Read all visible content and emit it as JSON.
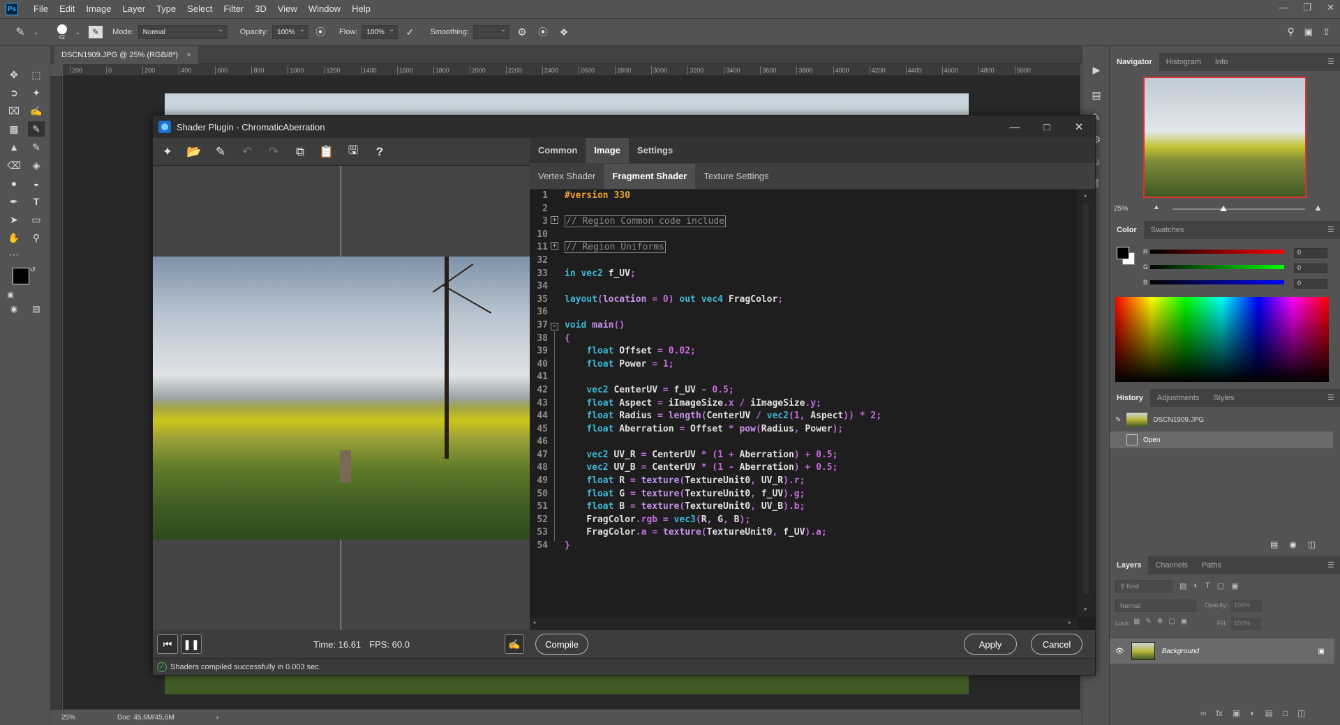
{
  "app": {
    "logo": "Ps",
    "menu": [
      "File",
      "Edit",
      "Image",
      "Layer",
      "Type",
      "Select",
      "Filter",
      "3D",
      "View",
      "Window",
      "Help"
    ]
  },
  "options_bar": {
    "brush_size": "42",
    "mode_label": "Mode:",
    "mode_value": "Normal",
    "opacity_label": "Opacity:",
    "opacity_value": "100%",
    "flow_label": "Flow:",
    "flow_value": "100%",
    "smoothing_label": "Smoothing:"
  },
  "document": {
    "tab_title": "DSCN1909.JPG @ 25% (RGB/8*)",
    "ruler_ticks": [
      "200",
      "0",
      "200",
      "400",
      "600",
      "800",
      "1000",
      "1200",
      "1400",
      "1600",
      "1800",
      "2000",
      "2200",
      "2400",
      "2600",
      "2800",
      "3000",
      "3200",
      "3400",
      "3600",
      "3800",
      "4000",
      "4200",
      "4400",
      "4600",
      "4800",
      "5000"
    ],
    "zoom": "25%",
    "doc_size": "Doc: 45,6M/45,6M"
  },
  "navigator": {
    "tabs": [
      "Navigator",
      "Histogram",
      "Info"
    ],
    "zoom": "25%"
  },
  "color_panel": {
    "tabs": [
      "Color",
      "Swatches"
    ],
    "channels": [
      {
        "label": "R",
        "value": "0"
      },
      {
        "label": "G",
        "value": "0"
      },
      {
        "label": "B",
        "value": "0"
      }
    ]
  },
  "history_panel": {
    "tabs": [
      "History",
      "Adjustments",
      "Styles"
    ],
    "items": [
      "DSCN1909.JPG",
      "Open"
    ]
  },
  "layers_panel": {
    "tabs": [
      "Layers",
      "Channels",
      "Paths"
    ],
    "filter_placeholder": "Kind",
    "blend_mode": "Normal",
    "opacity_label": "Opacity:",
    "opacity_value": "100%",
    "lock_label": "Lock:",
    "fill_label": "Fill:",
    "fill_value": "100%",
    "layer_name": "Background"
  },
  "plugin": {
    "title": "Shader Plugin - ChromaticAberration",
    "top_tabs": [
      "Common",
      "Image",
      "Settings"
    ],
    "active_top_tab": "Image",
    "shader_tabs": [
      "Vertex Shader",
      "Fragment Shader",
      "Texture Settings"
    ],
    "active_shader_tab": "Fragment Shader",
    "time_label": "Time: 16.61",
    "fps_label": "FPS: 60.0",
    "compile_label": "Compile",
    "apply_label": "Apply",
    "cancel_label": "Cancel",
    "status": "Shaders compiled successfully in 0.003 sec.",
    "line_numbers": [
      "1",
      "2",
      "3",
      "10",
      "11",
      "32",
      "33",
      "34",
      "35",
      "36",
      "37",
      "38",
      "39",
      "40",
      "41",
      "42",
      "43",
      "44",
      "45",
      "46",
      "47",
      "48",
      "49",
      "50",
      "51",
      "52",
      "53",
      "54"
    ],
    "code_lines": [
      "#version 330",
      "",
      "// Region Common code include",
      "",
      "// Region Uniforms",
      "",
      "in vec2 f_UV;",
      "",
      "layout(location = 0) out vec4 FragColor;",
      "",
      "void main()",
      "{",
      "    float Offset = 0.02;",
      "    float Power = 1;",
      "",
      "    vec2 CenterUV = f_UV - 0.5;",
      "    float Aspect = iImageSize.x / iImageSize.y;",
      "    float Radius = length(CenterUV / vec2(1, Aspect)) * 2;",
      "    float Aberration = Offset * pow(Radius, Power);",
      "",
      "    vec2 UV_R = CenterUV * (1 + Aberration) + 0.5;",
      "    vec2 UV_B = CenterUV * (1 - Aberration) + 0.5;",
      "    float R = texture(TextureUnit0, UV_R).r;",
      "    float G = texture(TextureUnit0, f_UV).g;",
      "    float B = texture(TextureUnit0, UV_B).b;",
      "    FragColor.rgb = vec3(R, G, B);",
      "    FragColor.a = texture(TextureUnit0, f_UV).a;",
      "}"
    ]
  },
  "colors": {
    "app_bg": "#535353",
    "editor_bg": "#1e1e1e",
    "keyword": "#3fb8d4",
    "function": "#c792ea",
    "number": "#c86be0",
    "version": "#f0a030",
    "success": "#4caf50"
  }
}
